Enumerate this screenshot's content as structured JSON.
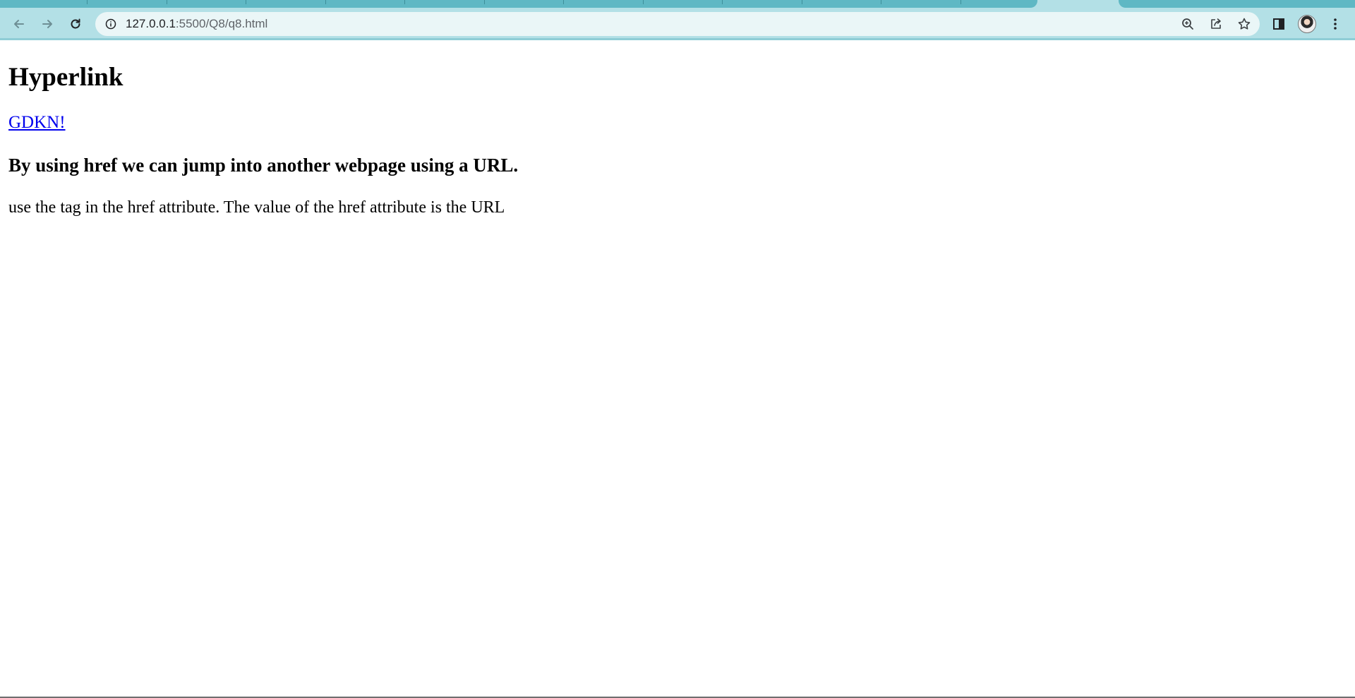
{
  "browser": {
    "url_host": "127.0.0.1",
    "url_rest": ":5500/Q8/q8.html"
  },
  "icons": {
    "back": "arrow-left-icon",
    "forward": "arrow-right-icon",
    "reload": "reload-icon",
    "site_info": "info-icon",
    "zoom": "zoom-icon",
    "share": "share-icon",
    "bookmark": "star-icon",
    "side_panel": "side-panel-icon",
    "profile": "avatar",
    "menu": "kebab-menu-icon"
  },
  "colors": {
    "chrome": "#b3e0e6",
    "tabs": "#5fb8c4",
    "link": "#0000ee"
  },
  "page": {
    "heading": "Hyperlink",
    "link_text": "GDKN!",
    "subheading": "By using href we can jump into another webpage using a URL.",
    "paragraph": "use the tag in the href attribute. The value of the href attribute is the URL"
  }
}
